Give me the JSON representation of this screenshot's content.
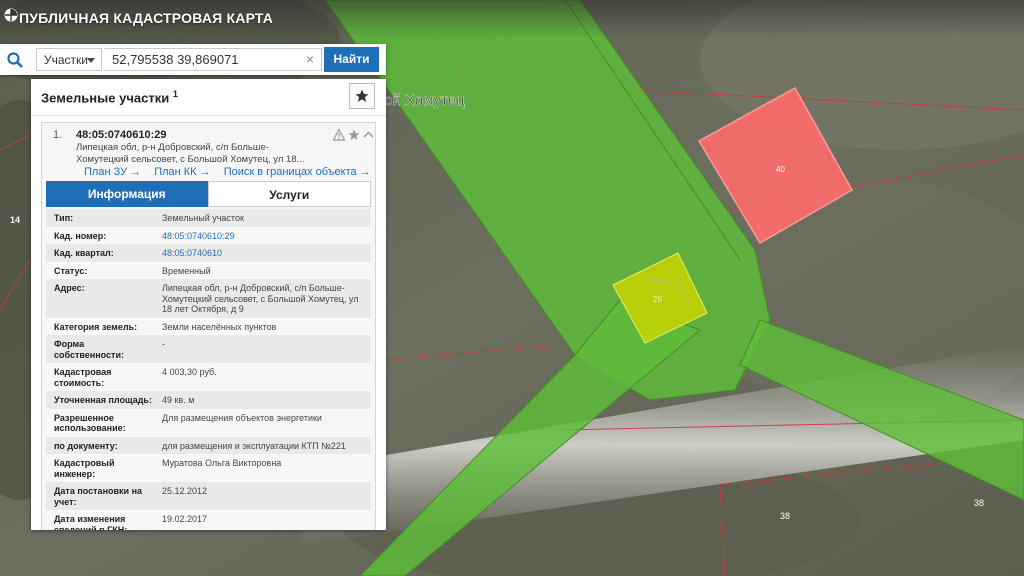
{
  "header": {
    "title": "ПУБЛИЧНАЯ КАДАСТРОВАЯ КАРТА"
  },
  "search": {
    "type_label": "Участки",
    "query": "52,795538 39,869071",
    "clear_label": "×",
    "submit_label": "Найти"
  },
  "panel": {
    "title": "Земельные участки",
    "count": "1",
    "result": {
      "index": "1.",
      "cad_number": "48:05:0740610:29",
      "address_short": "Липецкая обл, р-н Добровский, с/п Больше-Хомутецкий сельсовет, с Большой Хомутец, ул 18...",
      "links": [
        "План ЗУ →",
        "План КК →",
        "Поиск в границах объекта →"
      ],
      "tabs": [
        "Информация",
        "Услуги"
      ],
      "rows": [
        {
          "label": "Тип:",
          "value": "Земельный участок"
        },
        {
          "label": "Кад. номер:",
          "value": "48:05:0740610:29"
        },
        {
          "label": "Кад. квартал:",
          "value": "48:05:0740610"
        },
        {
          "label": "Статус:",
          "value": "Временный"
        },
        {
          "label": "Адрес:",
          "value": "Липецкая обл, р-н Добровский, с/п Больше-Хомутецкий сельсовет, с Большой Хомутец, ул 18 лет Октября, д 9"
        },
        {
          "label": "Категория земель:",
          "value": "Земли населённых пунктов"
        },
        {
          "label": "Форма собственности:",
          "value": "-"
        },
        {
          "label": "Кадастровая стоимость:",
          "value": "4 003,30 руб."
        },
        {
          "label": "Уточненная площадь:",
          "value": "49 кв. м"
        },
        {
          "label": "Разрешенное использование:",
          "value": "Для размещения объектов энергетики"
        },
        {
          "label": "по документу:",
          "value": "для размещения и эксплуатации КТП №221"
        },
        {
          "label": "Кадастровый инженер:",
          "value": "Муратова Ольга Викторовна"
        },
        {
          "label": "Дата постановки на учет:",
          "value": "25.12.2012"
        },
        {
          "label": "Дата изменения сведений в ГКН:",
          "value": "19.02.2017"
        }
      ]
    }
  },
  "map": {
    "street_label": "ой Хомутец",
    "labels": [
      "14",
      "40",
      "29",
      "38",
      "38"
    ]
  },
  "colors": {
    "accent": "#1e6fb8",
    "parcel_green": "#5fbd3a",
    "parcel_red": "#ff6b6b",
    "parcel_selected": "#c8d400"
  }
}
